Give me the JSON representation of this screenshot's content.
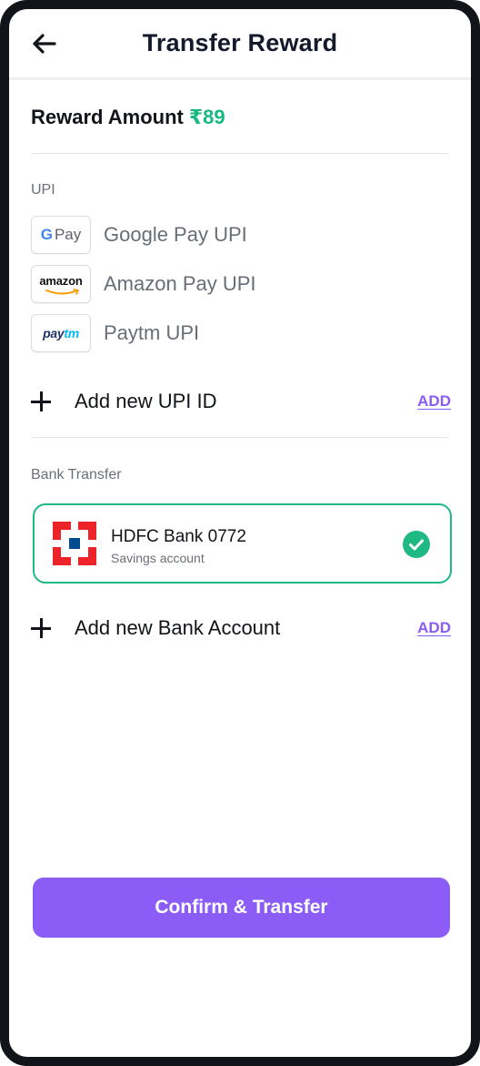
{
  "header": {
    "title": "Transfer Reward"
  },
  "reward": {
    "label": "Reward Amount",
    "amount": "₹89"
  },
  "upi": {
    "section_label": "UPI",
    "items": [
      {
        "label": "Google Pay UPI",
        "logo_text": "G Pay"
      },
      {
        "label": "Amazon Pay UPI",
        "logo_text": "amazon"
      },
      {
        "label": "Paytm UPI",
        "logo_text": "paytm"
      }
    ],
    "add_label": "Add new UPI ID",
    "add_link": "ADD"
  },
  "bank": {
    "section_label": "Bank Transfer",
    "selected": {
      "name": "HDFC Bank 0772",
      "type": "Savings account"
    },
    "add_label": "Add new Bank Account",
    "add_link": "ADD"
  },
  "footer": {
    "confirm_label": "Confirm & Transfer"
  },
  "colors": {
    "accent": "#8b5cf6",
    "success": "#1fb984",
    "reward": "#17b981",
    "hdfc_red": "#ed232a",
    "hdfc_blue": "#004c8f"
  }
}
